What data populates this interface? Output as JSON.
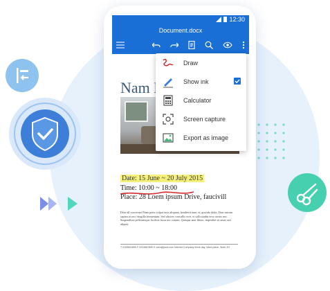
{
  "status": {
    "time": "12:30"
  },
  "document": {
    "filename": "Document.docx",
    "title_partial": "Nam E",
    "date_line": "Date: 15 June ~ 20 July 2015",
    "time_line": "Time: 10:00 ~ 18:00",
    "place_line": "Place: 28 Loem ipsum Drive, faucivill",
    "body_text": "Dear all concerned Nam porta volpat arcu aliquam, hendrerit nunc et, gravida dolor. Duis rutrum sapien at orci fringilla fermentum. Sed ultrices convallis eros, et sollicitudin eros cursus nec. Suspendisse pellentesque facilisis lacus nec rutrum. Quisque ante libero, imperdiet sit amet orci aliquet.",
    "footer_text": "T 0105601890  F 0234567890  E.com@post.com  Internet Company  Work day, Work place, Work 2H"
  },
  "toolbar": {
    "icons": [
      "menu-icon",
      "undo-icon",
      "redo-icon",
      "reading-mode-icon",
      "search-icon",
      "view-icon",
      "more-icon"
    ]
  },
  "menu": {
    "items": [
      {
        "label": "Draw",
        "icon": "draw-icon"
      },
      {
        "label": "Show ink",
        "icon": "show-ink-icon",
        "checked": true
      },
      {
        "label": "Calculator",
        "icon": "calculator-icon"
      },
      {
        "label": "Screen capture",
        "icon": "screen-capture-icon"
      },
      {
        "label": "Export as image",
        "icon": "export-image-icon"
      }
    ]
  },
  "colors": {
    "accent": "#1a6fd6",
    "shield": "#3d7ed8",
    "ink_red": "#d6282d",
    "highlight": "#f5f07a",
    "teal": "#46d0b0"
  }
}
